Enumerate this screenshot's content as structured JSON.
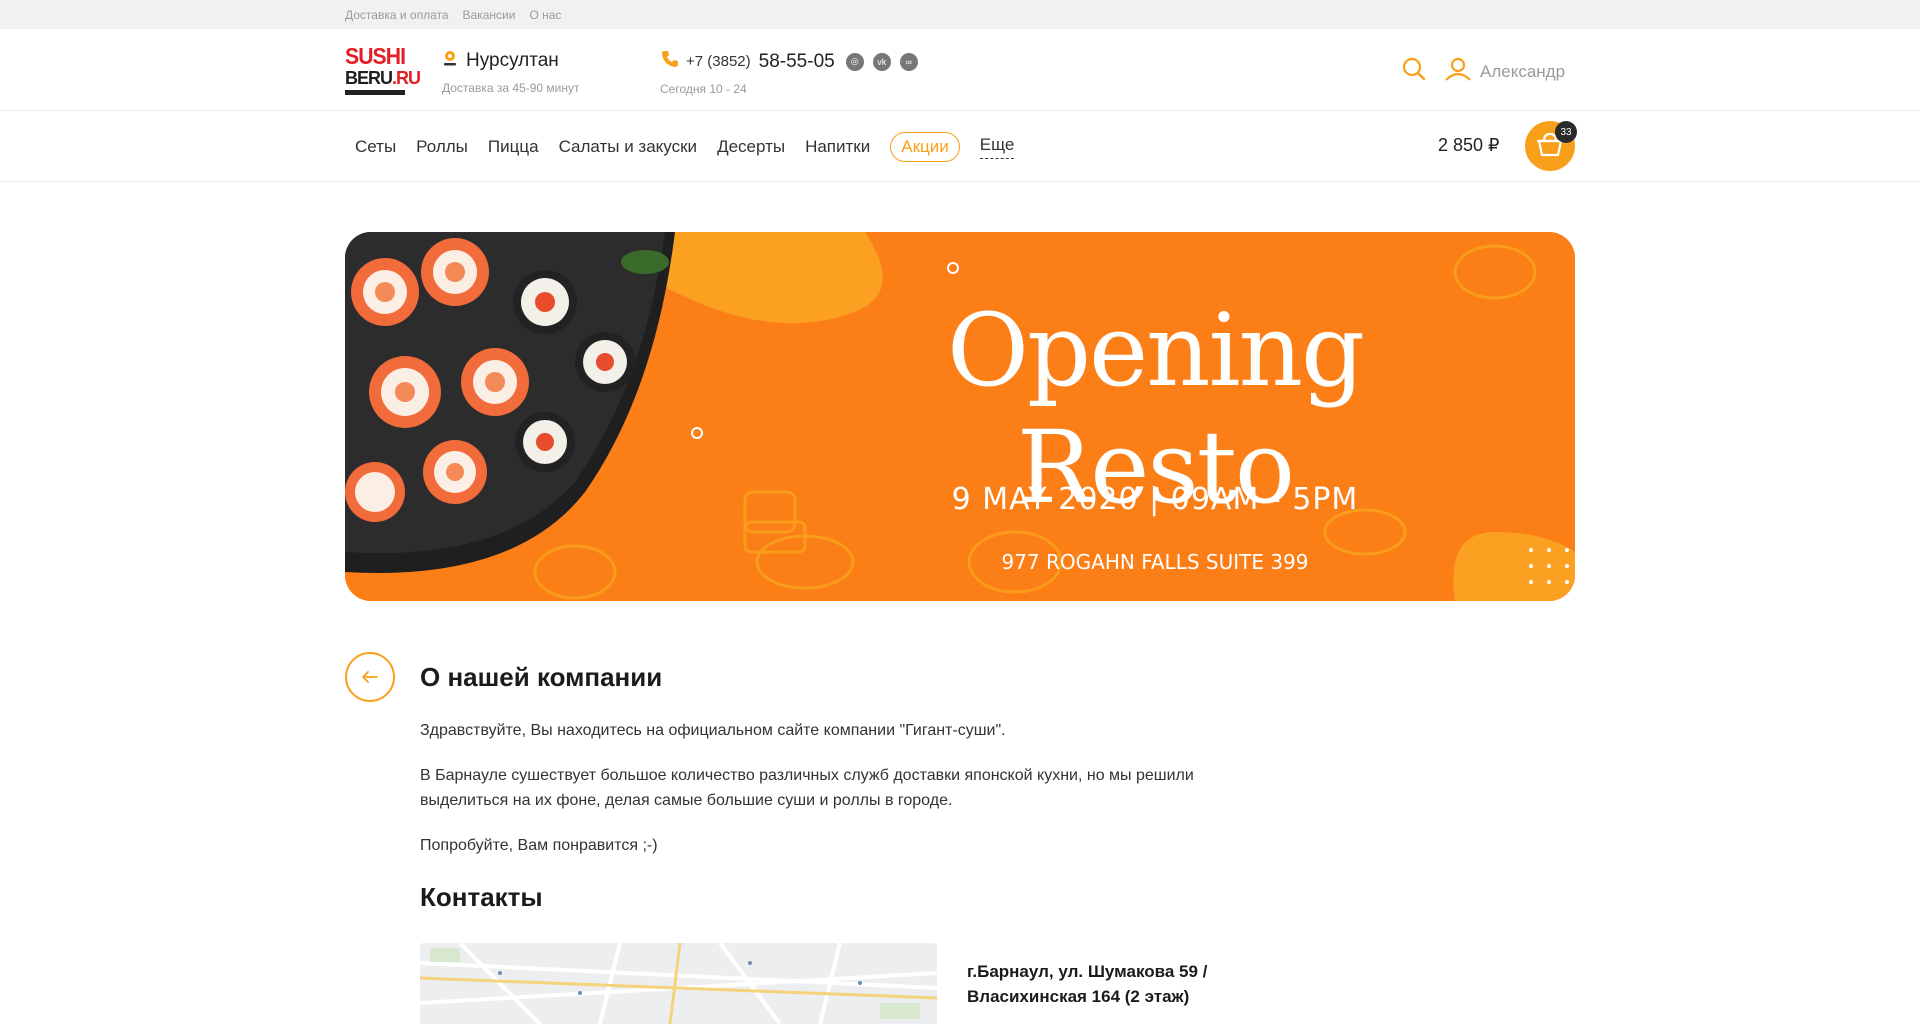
{
  "topbar": {
    "links": [
      "Доставка и оплата",
      "Вакансии",
      "О нас"
    ]
  },
  "header": {
    "logo_line1": "SUSHI",
    "logo_line2a": "BERU",
    "logo_line2b": ".RU",
    "city": "Нурсултан",
    "delivery_time": "Доставка за 45-90 минут",
    "phone_code": "+7 (3852)",
    "phone_number": "58-55-05",
    "hours": "Сегодня 10 - 24",
    "user_name": "Александр"
  },
  "nav": {
    "items": [
      "Сеты",
      "Роллы",
      "Пицца",
      "Салаты и закуски",
      "Десерты",
      "Напитки"
    ],
    "promo": "Акции",
    "more": "Еще",
    "cart_sum": "2 850 ₽",
    "cart_count": "33"
  },
  "banner": {
    "title": "Opening Resto",
    "date": "9 MAY 2020 | 09AM - 5PM",
    "address": "977 ROGAHN FALLS SUITE 399"
  },
  "about": {
    "title": "О нашей компании",
    "p1": "Здравствуйте, Вы находитесь на официальном сайте компании \"Гигант-суши\".",
    "p2": "В Барнауле сушествует большое количество различных служб доставки японской кухни, но мы решили выделиться на их фоне, делая самые большие суши и роллы в городе.",
    "p3": "Попробуйте, Вам понравится ;-)"
  },
  "contacts": {
    "title": "Контакты",
    "address": "г.Барнаул, ул. Шумакова 59 / Власихинская 164 (2 этаж)"
  },
  "colors": {
    "accent": "#f9a01b",
    "banner": "#fb7e17",
    "logo_red": "#e31e24"
  }
}
